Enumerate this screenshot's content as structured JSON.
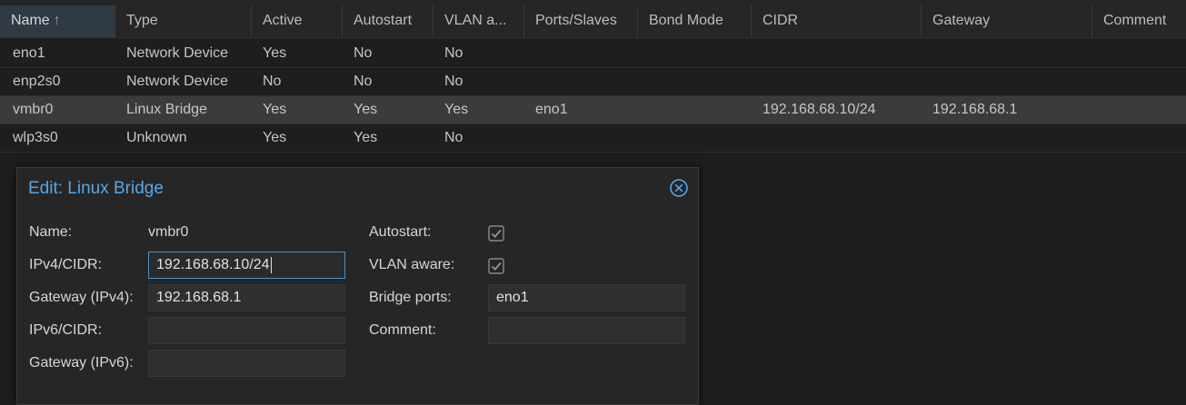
{
  "table": {
    "columns": [
      {
        "label": "Name",
        "sorted": true
      },
      {
        "label": "Type"
      },
      {
        "label": "Active"
      },
      {
        "label": "Autostart"
      },
      {
        "label": "VLAN a..."
      },
      {
        "label": "Ports/Slaves"
      },
      {
        "label": "Bond Mode"
      },
      {
        "label": "CIDR"
      },
      {
        "label": "Gateway"
      },
      {
        "label": "Comment"
      }
    ],
    "sort_arrow": "↑",
    "rows": [
      {
        "name": "eno1",
        "type": "Network Device",
        "active": "Yes",
        "autostart": "No",
        "vlan": "No",
        "ports": "",
        "bond": "",
        "cidr": "",
        "gateway": "",
        "comment": ""
      },
      {
        "name": "enp2s0",
        "type": "Network Device",
        "active": "No",
        "autostart": "No",
        "vlan": "No",
        "ports": "",
        "bond": "",
        "cidr": "",
        "gateway": "",
        "comment": ""
      },
      {
        "name": "vmbr0",
        "type": "Linux Bridge",
        "active": "Yes",
        "autostart": "Yes",
        "vlan": "Yes",
        "ports": "eno1",
        "bond": "",
        "cidr": "192.168.68.10/24",
        "gateway": "192.168.68.1",
        "comment": ""
      },
      {
        "name": "wlp3s0",
        "type": "Unknown",
        "active": "Yes",
        "autostart": "Yes",
        "vlan": "No",
        "ports": "",
        "bond": "",
        "cidr": "",
        "gateway": "",
        "comment": ""
      }
    ]
  },
  "dialog": {
    "title": "Edit: Linux Bridge",
    "left": {
      "name_label": "Name:",
      "name_value": "vmbr0",
      "ipv4_label": "IPv4/CIDR:",
      "ipv4_value": "192.168.68.10/24",
      "gw4_label": "Gateway (IPv4):",
      "gw4_value": "192.168.68.1",
      "ipv6_label": "IPv6/CIDR:",
      "ipv6_value": "",
      "gw6_label": "Gateway (IPv6):",
      "gw6_value": ""
    },
    "right": {
      "autostart_label": "Autostart:",
      "autostart_checked": true,
      "vlan_label": "VLAN aware:",
      "vlan_checked": true,
      "ports_label": "Bridge ports:",
      "ports_value": "eno1",
      "comment_label": "Comment:",
      "comment_value": ""
    }
  },
  "colors": {
    "accent": "#57a7e6",
    "background": "#1e1e1e",
    "selected_row": "#3b3b3b"
  }
}
